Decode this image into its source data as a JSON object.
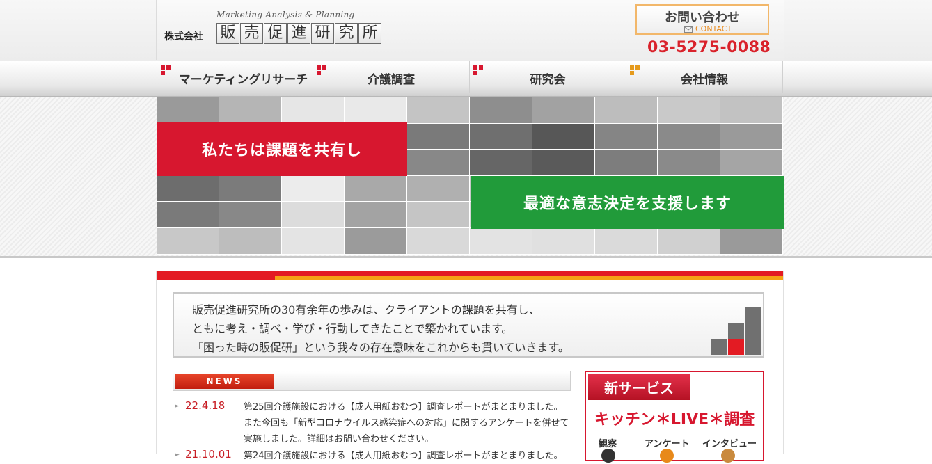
{
  "header": {
    "logo_sub": "Marketing Analysis & Planning",
    "logo_prefix": "株式会社",
    "logo_chars": [
      "販",
      "売",
      "促",
      "進",
      "研",
      "究",
      "所"
    ],
    "contact_label": "お問い合わせ",
    "contact_sub": "CONTACT",
    "phone": "03-5275-0088"
  },
  "nav": {
    "items": [
      {
        "label": "マーケティングリサーチ"
      },
      {
        "label": "介護調査"
      },
      {
        "label": "研究会"
      },
      {
        "label": "会社情報"
      }
    ]
  },
  "hero": {
    "line1": "私たちは課題を共有し",
    "line2": "最適な意志決定を支援します"
  },
  "message": {
    "lines": [
      "販売促進研究所の30有余年の歩みは、クライアントの課題を共有し、",
      "ともに考え・調べ・学び・行動してきたことで築かれています。",
      "「困った時の販促研」という我々の存在意味をこれからも貫いていきます。"
    ]
  },
  "news": {
    "heading": "NEWS",
    "items": [
      {
        "date": "22.4.18",
        "text": "第25回介護施設における【成人用紙おむつ】調査レポートがまとまりました。また今回も「新型コロナウイルス感染症への対応」に関するアンケートを併せて実施しました。詳細はお問い合わせください。"
      },
      {
        "date": "21.10.01",
        "text": "第24回介護施設における【成人用紙おむつ】調査レポートがまとまりました。"
      }
    ]
  },
  "service": {
    "tab": "新サービス",
    "title": "キッチン＊LIVE＊調査",
    "labels": [
      "観察",
      "アンケート",
      "インタビュー"
    ]
  },
  "colors": {
    "red": "#d7172f",
    "green": "#219b3a",
    "orange": "#f5a214",
    "date_red": "#c81e25"
  }
}
